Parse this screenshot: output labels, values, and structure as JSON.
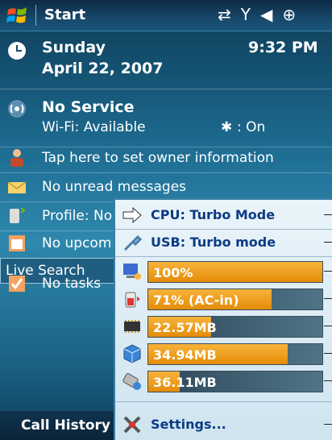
{
  "titlebar": {
    "start_label": "Start"
  },
  "today": {
    "day": "Sunday",
    "date": "April 22, 2007",
    "time": "9:32 PM",
    "no_service": "No Service",
    "wifi": "Wi-Fi: Available",
    "bluetooth": ": On",
    "owner": "Tap here to set owner information",
    "messages": "No unread messages",
    "profile": "Profile: No",
    "appointments": "No upcom",
    "live_search": "Live Search",
    "tasks": "No tasks"
  },
  "softbar": {
    "left_label": "Call History"
  },
  "menu": {
    "cpu": "CPU: Turbo Mode",
    "usb": "USB: Turbo mode",
    "settings": "Settings...",
    "bars": [
      {
        "name": "backlight",
        "label": "100%",
        "fraction": 1.0
      },
      {
        "name": "battery",
        "label": "71% (AC-in)",
        "fraction": 0.71
      },
      {
        "name": "memory",
        "label": "22.57MB",
        "fraction": 0.36
      },
      {
        "name": "storage",
        "label": "34.94MB",
        "fraction": 0.8
      },
      {
        "name": "card",
        "label": "36.11MB",
        "fraction": 0.18
      }
    ]
  },
  "colors": {
    "accent": "#e48c08",
    "menu_text": "#0c3b84"
  }
}
